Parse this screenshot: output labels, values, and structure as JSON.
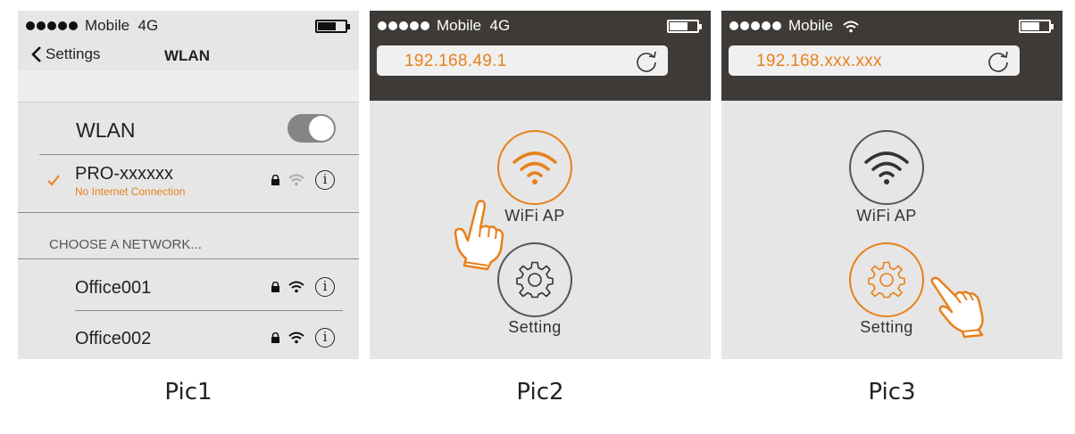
{
  "pic1": {
    "status": {
      "carrier": "Mobile",
      "network": "4G"
    },
    "nav": {
      "back_label": "Settings",
      "title": "WLAN"
    },
    "wlan_toggle": {
      "label": "WLAN",
      "on": true
    },
    "connected": {
      "name": "PRO-xxxxxx",
      "subtitle": "No Internet Connection"
    },
    "section_header": "CHOOSE A NETWORK...",
    "networks": [
      {
        "name": "Office001"
      },
      {
        "name": "Office002"
      }
    ],
    "info_glyph": "i",
    "caption": "Pic1"
  },
  "pic2": {
    "status": {
      "carrier": "Mobile",
      "network": "4G"
    },
    "address": "192.168.49.1",
    "wifi_button": {
      "label": "WiFi AP",
      "icon": "wifi-icon"
    },
    "setting_button": {
      "label": "Setting",
      "icon": "gear-icon"
    },
    "caption": "Pic2"
  },
  "pic3": {
    "status": {
      "carrier": "Mobile",
      "network": ""
    },
    "address": "192.168.xxx.xxx",
    "wifi_button": {
      "label": "WiFi AP",
      "icon": "wifi-icon"
    },
    "setting_button": {
      "label": "Setting",
      "icon": "gear-icon"
    },
    "caption": "Pic3"
  },
  "colors": {
    "accent": "#e8801c",
    "dark_header": "#3d3a37",
    "panel_bg": "#e6e6e6"
  }
}
